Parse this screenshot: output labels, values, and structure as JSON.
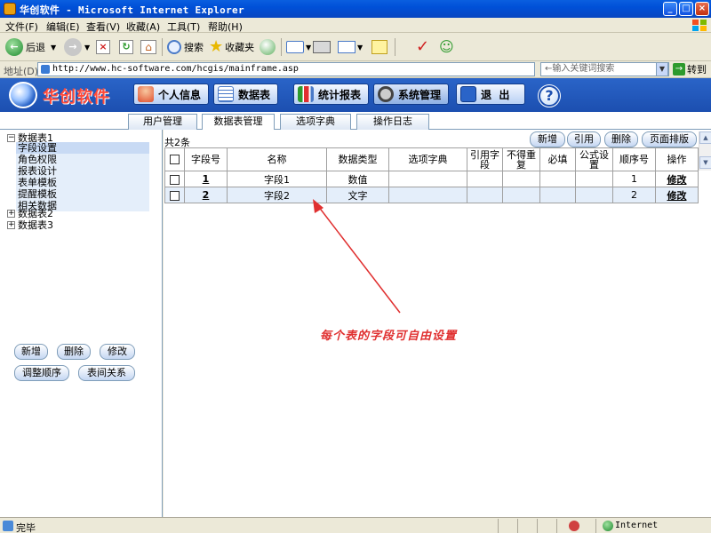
{
  "window": {
    "title": "华创软件 - Microsoft Internet Explorer",
    "min_glyph": "_",
    "max_glyph": "□",
    "close_glyph": "×"
  },
  "menu": {
    "items": [
      "文件(F)",
      "编辑(E)",
      "查看(V)",
      "收藏(A)",
      "工具(T)",
      "帮助(H)"
    ]
  },
  "toolbar": {
    "back_label": "后退",
    "search_label": "搜索",
    "favorites_label": "收藏夹"
  },
  "address": {
    "label": "地址(D)",
    "url": "http://www.hc-software.com/hcgis/mainframe.asp",
    "search_placeholder": "←输入关键词搜索",
    "go_label": "转到"
  },
  "app": {
    "brand": "华创软件",
    "nav": [
      "个人信息",
      "数据表",
      "统计报表",
      "系统管理",
      "退  出"
    ],
    "help_glyph": "?"
  },
  "tabs": [
    "用户管理",
    "数据表管理",
    "选项字典",
    "操作日志"
  ],
  "tree": {
    "nodes": [
      {
        "label": "数据表1",
        "toggle": "−"
      },
      {
        "label": "数据表2",
        "toggle": "+"
      },
      {
        "label": "数据表3",
        "toggle": "+"
      }
    ],
    "children": [
      "字段设置",
      "角色权限",
      "报表设计",
      "表单模板",
      "提醒模板",
      "相关数据"
    ]
  },
  "left_buttons": {
    "add": "新增",
    "delete": "删除",
    "edit": "修改",
    "reorder": "调整顺序",
    "relations": "表间关系"
  },
  "content": {
    "count": "共2条",
    "actions": [
      "新增",
      "引用",
      "删除",
      "页面排版"
    ],
    "headers": [
      "字段号",
      "名称",
      "数据类型",
      "选项字典",
      "引用字段",
      "不得重复",
      "必填",
      "公式设置",
      "顺序号",
      "操作"
    ],
    "rows": [
      {
        "id": "1",
        "name": "字段1",
        "type": "数值",
        "dict": "",
        "ref": "",
        "unique": "",
        "required": "",
        "formula": "",
        "order": "1",
        "op": "修改"
      },
      {
        "id": "2",
        "name": "字段2",
        "type": "文字",
        "dict": "",
        "ref": "",
        "unique": "",
        "required": "",
        "formula": "",
        "order": "2",
        "op": "修改"
      }
    ]
  },
  "annotation": "每个表的字段可自由设置",
  "status": {
    "text": "完毕",
    "zone": "Internet"
  },
  "colors": {
    "header_blue": "#2a64c8",
    "brand_red": "#ff4a3a",
    "annotation_red": "#e03030"
  }
}
